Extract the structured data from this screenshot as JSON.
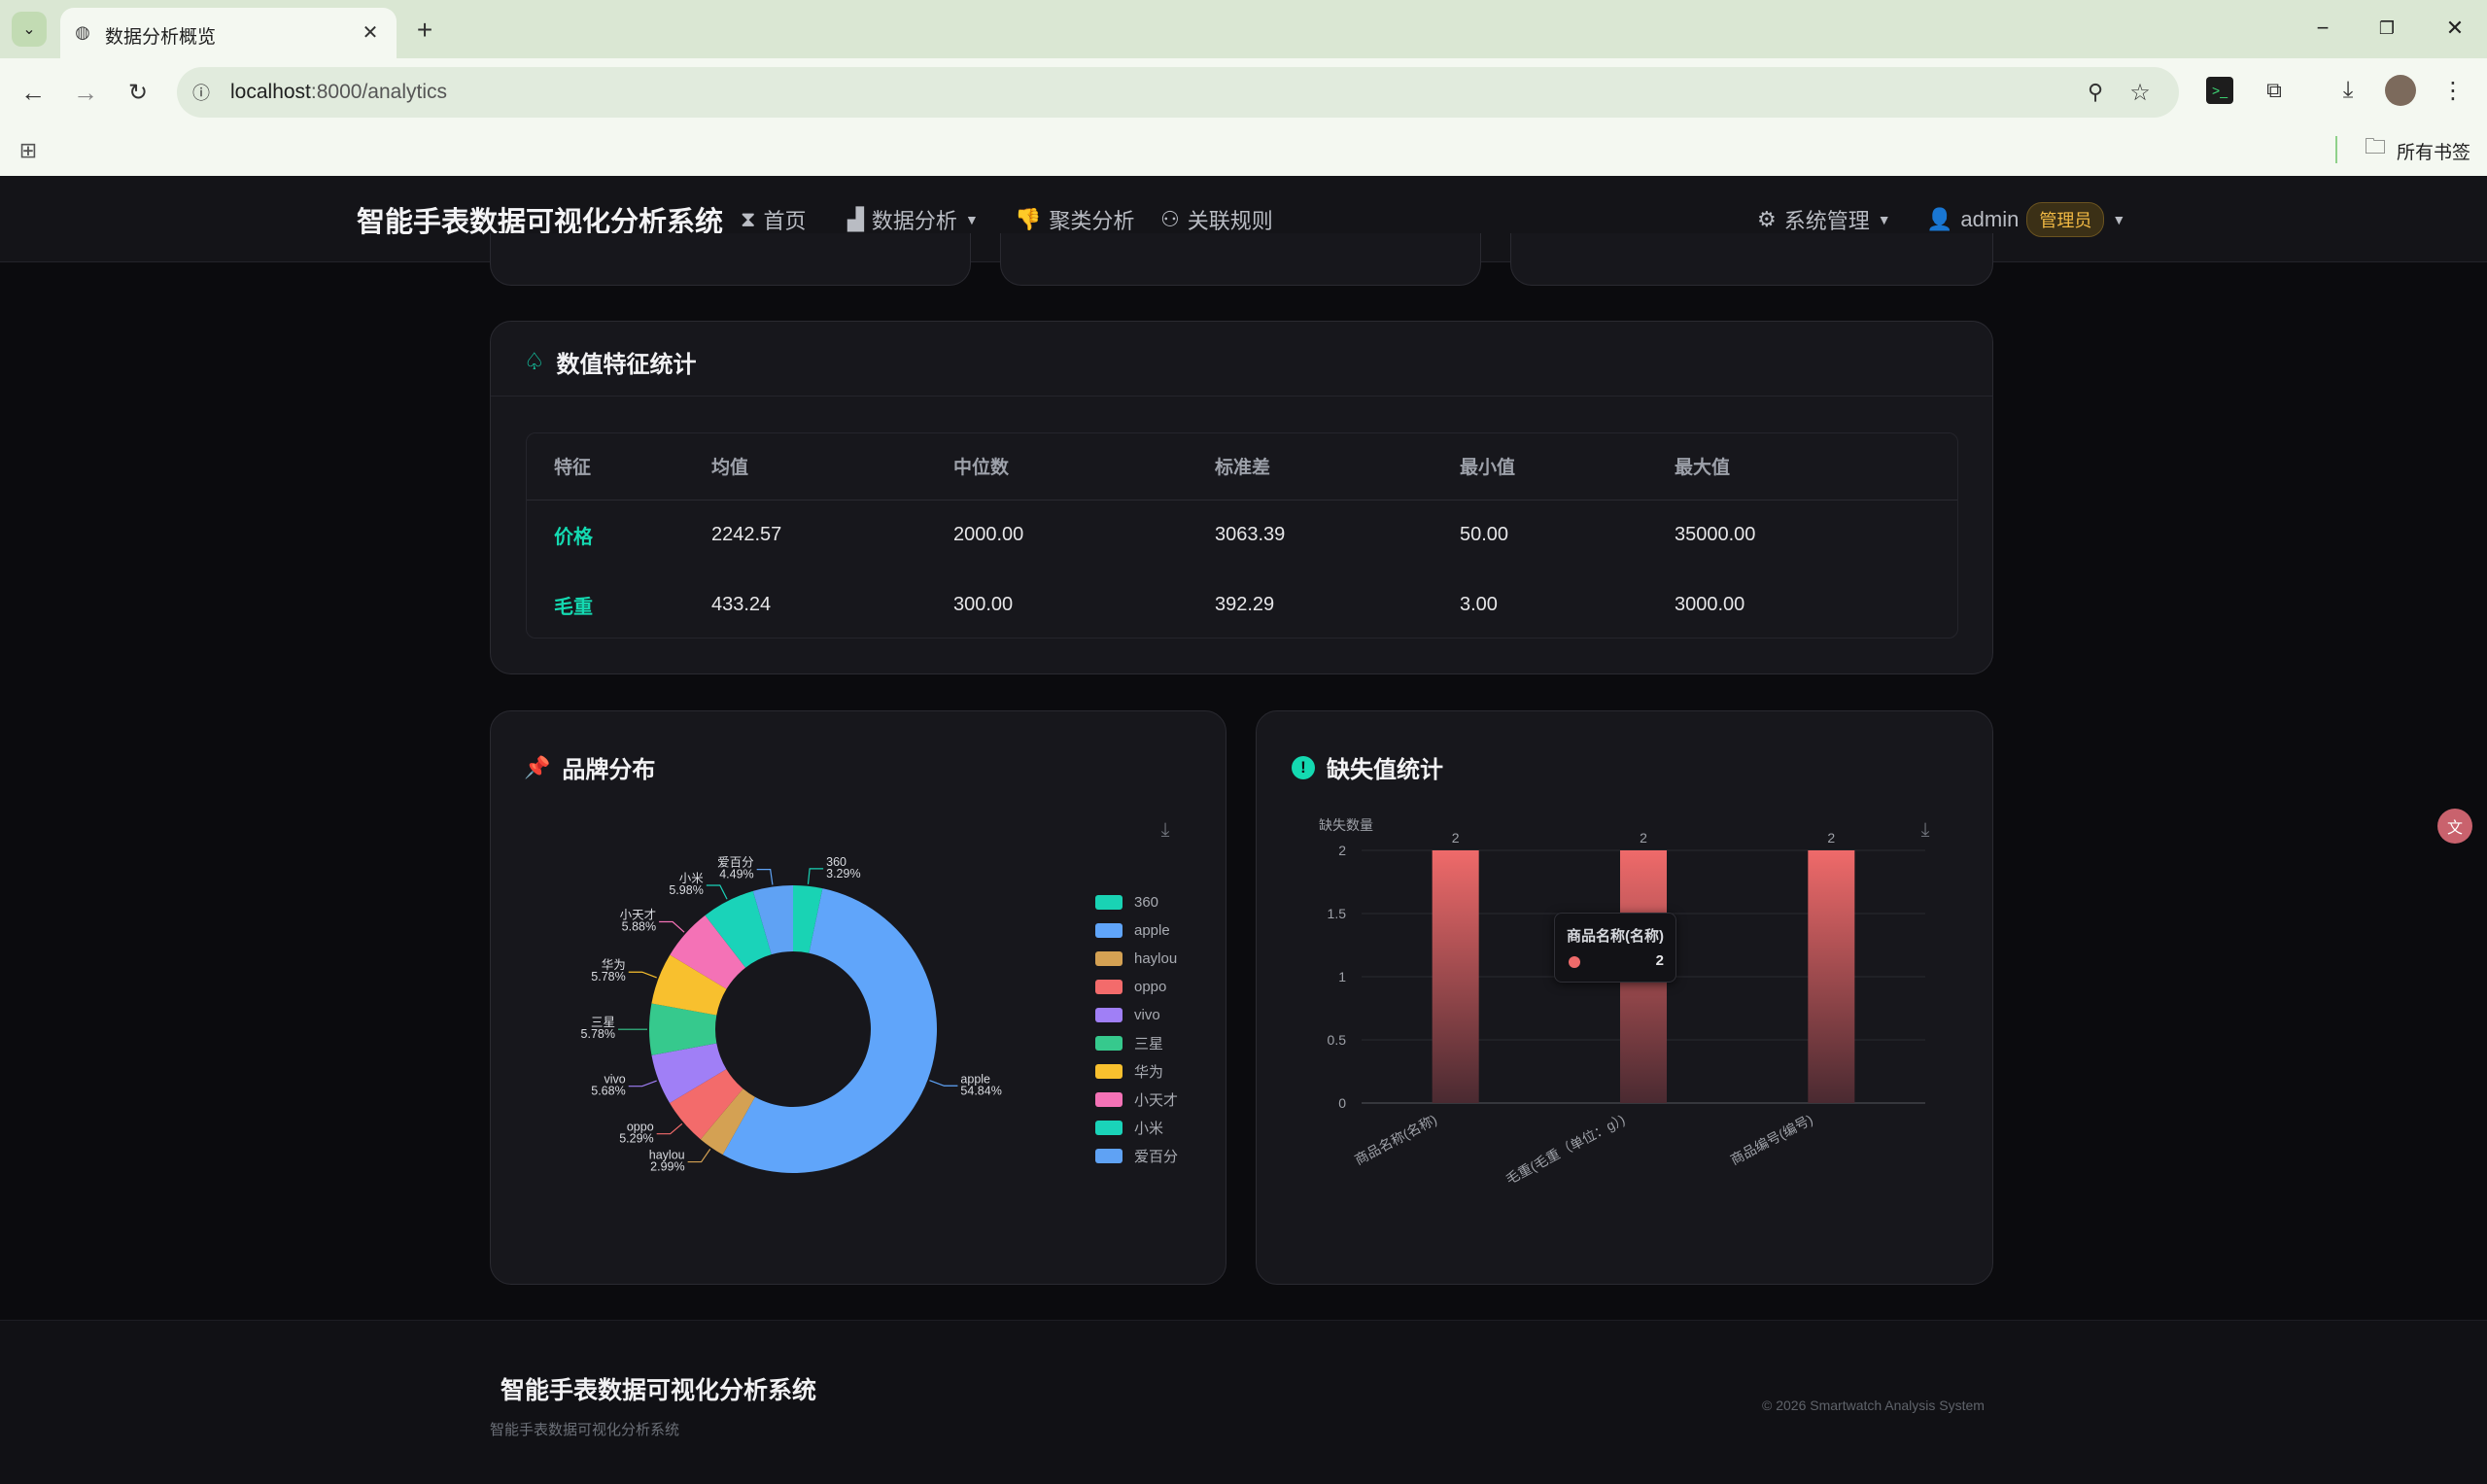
{
  "browser": {
    "tab_title": "数据分析概览",
    "url_host": "localhost",
    "url_rest": ":8000/analytics",
    "bookmarks_label": "所有书签"
  },
  "nav": {
    "brand": "智能手表数据可视化分析系统",
    "items": [
      {
        "label": "首页",
        "icon": "hourglass-icon"
      },
      {
        "label": "数据分析",
        "icon": "bar-chart-icon"
      },
      {
        "label": "聚类分析",
        "icon": "thumbs-down-icon"
      },
      {
        "label": "关联规则",
        "icon": "users-icon"
      }
    ],
    "system": "系统管理",
    "user": "admin",
    "role": "管理员"
  },
  "stats": {
    "title": "数值特征统计",
    "columns": [
      "特征",
      "均值",
      "中位数",
      "标准差",
      "最小值",
      "最大值"
    ],
    "rows": [
      [
        "价格",
        "2242.57",
        "2000.00",
        "3063.39",
        "50.00",
        "35000.00"
      ],
      [
        "毛重",
        "433.24",
        "300.00",
        "392.29",
        "3.00",
        "3000.00"
      ]
    ]
  },
  "brand_dist": {
    "title": "品牌分布"
  },
  "missing": {
    "title": "缺失值统计",
    "tooltip": {
      "name": "商品名称(名称)",
      "value": "2"
    }
  },
  "footer": {
    "title": "智能手表数据可视化分析系统",
    "subtitle": "智能手表数据可视化分析系统",
    "copyright": "© 2026 Smartwatch Analysis System"
  },
  "colors": {
    "accent": "#14d9b1",
    "bar": "#ee6b6b",
    "role_badge": "#f1b944"
  },
  "chart_data": [
    {
      "type": "pie",
      "title": "品牌分布",
      "categories": [
        "360",
        "apple",
        "haylou",
        "oppo",
        "vivo",
        "三星",
        "华为",
        "小天才",
        "小米",
        "爱百分"
      ],
      "values": [
        3.29,
        54.84,
        2.99,
        5.29,
        5.68,
        5.78,
        5.78,
        5.88,
        5.98,
        4.49
      ],
      "labels": [
        "3.29%",
        "54.84%",
        "2.99%",
        "5.29%",
        "5.68%",
        "5.78%",
        "5.78%",
        "5.88%",
        "5.98%",
        "4.49%"
      ],
      "colors": [
        "#19d3b4",
        "#60a5fa",
        "#d4a153",
        "#f36b6b",
        "#a07ff6",
        "#36c98d",
        "#f8c02e",
        "#f472b6",
        "#1ad3b9",
        "#5fa2f4"
      ],
      "legend": "right"
    },
    {
      "type": "bar",
      "title": "缺失值统计",
      "ylabel": "缺失数量",
      "categories": [
        "商品名称(名称)",
        "毛重(毛重（单位：g）)",
        "商品编号(编号)"
      ],
      "values": [
        2,
        2,
        2
      ],
      "ylim": [
        0,
        2
      ],
      "yticks": [
        "0",
        "0.5",
        "1",
        "1.5",
        "2"
      ],
      "grid": true
    }
  ]
}
